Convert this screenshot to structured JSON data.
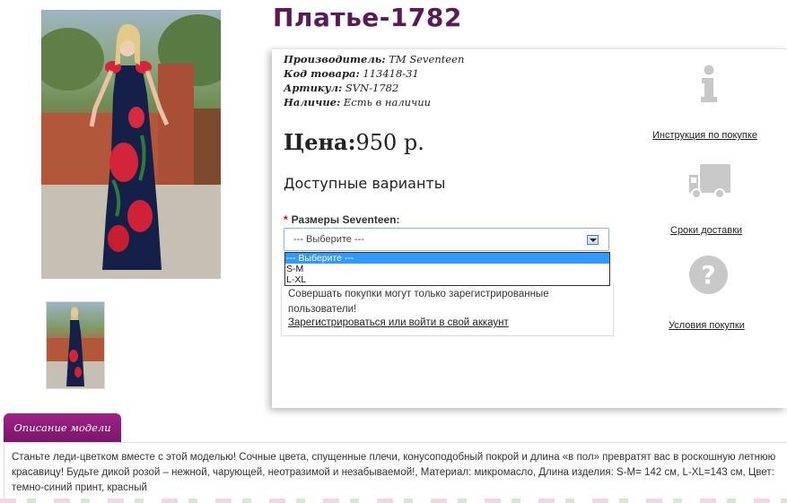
{
  "product": {
    "title": "Платье-1782"
  },
  "specs": {
    "manufacturer_label": "Производитель:",
    "manufacturer_value": "ТМ Seventeen",
    "code_label": "Код товара:",
    "code_value": "113418-31",
    "article_label": "Артикул:",
    "article_value": "SVN-1782",
    "availability_label": "Наличие:",
    "availability_value": "Есть в наличии"
  },
  "price": {
    "label": "Цена:",
    "value": "950 р."
  },
  "options": {
    "heading": "Доступные варианты",
    "size_label": "Размеры Seventeen:",
    "required_mark": "*",
    "selected": "--- Выберите ---",
    "list": [
      "--- Выберите ---",
      "S-M",
      "L-XL"
    ]
  },
  "register": {
    "notice": "Совершать покупки могут только зарегистрированные пользователи!",
    "link": "Зарегистрироваться или войти в свой аккаунт"
  },
  "side_links": {
    "instructions": "Инструкция по покупке",
    "delivery": "Сроки доставки",
    "terms": "Условия покупки"
  },
  "description": {
    "tab": "Описание модели",
    "text": "Станьте леди-цветком вместе с этой моделью! Сочные цвета, спущенные плечи, конусоподобный покрой и длина «в пол» превратят вас в роскошную летнюю красавицу! Будьте дикой розой – нежной, чарующей, неотразимой и незабываемой!, Материал: микромасло, Длина изделия: S-M= 142 см, L-XL=143 см, Цвет: темно-синий принт, красный"
  },
  "colors": {
    "title": "#5a1a55",
    "tab": "#8b1c78",
    "icon_gray": "#c8c8c8",
    "selected_option": "#3399ff"
  },
  "icons": [
    "info-icon",
    "truck-icon",
    "question-icon"
  ]
}
